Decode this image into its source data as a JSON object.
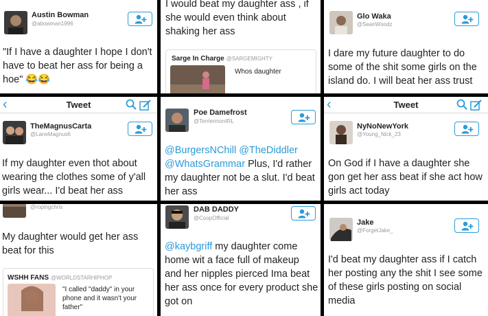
{
  "colors": {
    "accent": "#2a9bd8",
    "text": "#222222",
    "muted": "#999999",
    "border": "#dddddd"
  },
  "icons": {
    "follow": "add-user-icon",
    "back": "chevron-left-icon",
    "search": "search-icon",
    "compose": "compose-icon"
  },
  "tweets": [
    {
      "name": "Austin Bowman",
      "handle": "@abowman1996",
      "text": "\"If I have a daughter I hope I don't have to beat her ass for being a hoe\" 😂😂"
    },
    {
      "text": "I would beat my daughter ass , if she would even think about shaking her ass",
      "quote": {
        "name": "Sarge In Charge",
        "handle": "@SARGEMIGHTY",
        "text": "Whos daughter"
      }
    },
    {
      "name": "Glo Waka",
      "handle": "@SeanWoodz",
      "text": "I dare my future daughter to do some of the shit some girls on the island do. I will beat her ass trust"
    },
    {
      "nav_title": "Tweet",
      "name": "TheMagnusCarta",
      "handle": "@LaneMagnus6",
      "text": "If my daughter even thot about wearing the clothes some of y'all girls wear... I'd beat her ass"
    },
    {
      "name": "Poe Damefrost",
      "handle": "@TerriermonIRL",
      "mentions": [
        "@BurgersNChill",
        "@TheDiddler",
        "@WhatsGrammar"
      ],
      "text": "Plus, I'd rather my daughter not be a slut. I'd beat her ass"
    },
    {
      "nav_title": "Tweet",
      "name": "NyNoNewYork",
      "handle": "@Young_Nick_23",
      "text": "On God if I have a daughter she gon get her ass beat if she act how girls act today"
    },
    {
      "handle": "@ropingchris",
      "text": "My daughter would get her ass beat for this",
      "quote": {
        "name": "WSHH FANS",
        "handle": "@WORLDSTARHIPHOP",
        "text": "\"I called \"daddy\" in your phone and it wasn't your father\""
      }
    },
    {
      "name": "DAB DADDY",
      "handle": "@CoopOfficial",
      "mentions": [
        "@kaybgriff"
      ],
      "text": "my daughter come home wit a face full of makeup and her nipples pierced Ima beat her ass once for every product she got on"
    },
    {
      "name": "Jake",
      "handle": "@ForgetJake_",
      "text": "I'd beat my daughter ass if I catch her posting any the shit I see some of these girls posting on social media"
    }
  ]
}
